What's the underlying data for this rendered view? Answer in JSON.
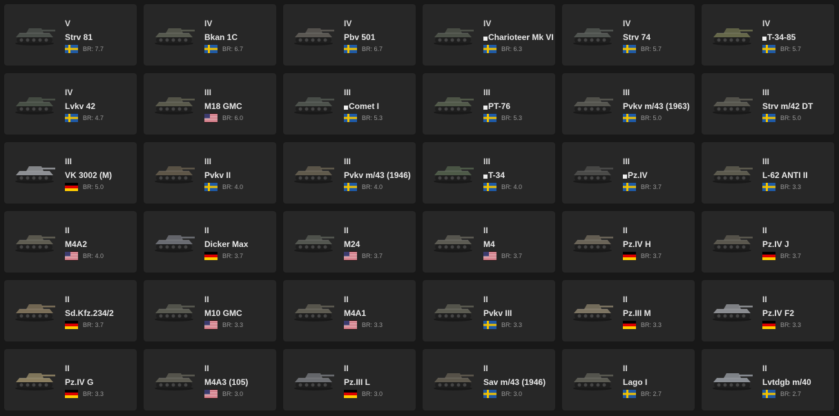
{
  "br_label": "BR:",
  "colors": {
    "background": "#181818",
    "card": "#272727",
    "sweden_blue": "#1f5aa6",
    "sweden_yellow": "#f2c200",
    "germany_red": "#dd0000",
    "germany_gold": "#ffcc00",
    "usa_red": "#b22234",
    "usa_blue": "#3c3b6e"
  },
  "vehicles": [
    {
      "rank": "V",
      "name": "Strv 81",
      "nation": "sweden",
      "br": "7.7",
      "icon": "tank-icon",
      "hue": "#4a4f4a",
      "marked": false
    },
    {
      "rank": "IV",
      "name": "Bkan 1C",
      "nation": "sweden",
      "br": "6.7",
      "icon": "spg-icon",
      "hue": "#56594e",
      "marked": false
    },
    {
      "rank": "IV",
      "name": "Pbv 501",
      "nation": "sweden",
      "br": "6.7",
      "icon": "apc-icon",
      "hue": "#5a5752",
      "marked": false
    },
    {
      "rank": "IV",
      "name": "Charioteer Mk VI",
      "nation": "sweden",
      "br": "6.3",
      "icon": "tank-icon",
      "hue": "#4c5148",
      "marked": true
    },
    {
      "rank": "IV",
      "name": "Strv 74",
      "nation": "sweden",
      "br": "5.7",
      "icon": "tank-icon",
      "hue": "#505450",
      "marked": false
    },
    {
      "rank": "IV",
      "name": "T-34-85",
      "nation": "sweden",
      "br": "5.7",
      "icon": "tank-icon",
      "hue": "#66684a",
      "marked": true
    },
    {
      "rank": "IV",
      "name": "Lvkv 42",
      "nation": "sweden",
      "br": "4.7",
      "icon": "spaa-icon",
      "hue": "#485046",
      "marked": false
    },
    {
      "rank": "III",
      "name": "M18 GMC",
      "nation": "usa",
      "br": "6.0",
      "icon": "tank-destroyer-icon",
      "hue": "#5a5a4c",
      "marked": false
    },
    {
      "rank": "III",
      "name": "Comet I",
      "nation": "sweden",
      "br": "5.3",
      "icon": "tank-icon",
      "hue": "#4d524c",
      "marked": true
    },
    {
      "rank": "III",
      "name": "PT-76",
      "nation": "sweden",
      "br": "5.3",
      "icon": "light-tank-icon",
      "hue": "#525a4a",
      "marked": true
    },
    {
      "rank": "III",
      "name": "Pvkv m/43 (1963)",
      "nation": "sweden",
      "br": "5.0",
      "icon": "tank-destroyer-icon",
      "hue": "#55554f",
      "marked": false
    },
    {
      "rank": "III",
      "name": "Strv m/42 DT",
      "nation": "sweden",
      "br": "5.0",
      "icon": "tank-icon",
      "hue": "#58574f",
      "marked": false
    },
    {
      "rank": "III",
      "name": "VK 3002 (M)",
      "nation": "germany",
      "br": "5.0",
      "icon": "tank-icon",
      "hue": "#8e9094",
      "marked": false
    },
    {
      "rank": "III",
      "name": "Pvkv II",
      "nation": "sweden",
      "br": "4.0",
      "icon": "tank-destroyer-icon",
      "hue": "#5e5648",
      "marked": false
    },
    {
      "rank": "III",
      "name": "Pvkv m/43 (1946)",
      "nation": "sweden",
      "br": "4.0",
      "icon": "tank-destroyer-icon",
      "hue": "#605a4c",
      "marked": false
    },
    {
      "rank": "III",
      "name": "T-34",
      "nation": "sweden",
      "br": "4.0",
      "icon": "tank-icon",
      "hue": "#4e5a48",
      "marked": true
    },
    {
      "rank": "III",
      "name": "Pz.IV",
      "nation": "sweden",
      "br": "3.7",
      "icon": "tank-icon",
      "hue": "#4a4a48",
      "marked": true
    },
    {
      "rank": "III",
      "name": "L-62 ANTI II",
      "nation": "sweden",
      "br": "3.3",
      "icon": "spaa-icon",
      "hue": "#5c5a4e",
      "marked": false
    },
    {
      "rank": "II",
      "name": "M4A2",
      "nation": "usa",
      "br": "4.0",
      "icon": "tank-icon",
      "hue": "#5f5d52",
      "marked": false
    },
    {
      "rank": "II",
      "name": "Dicker Max",
      "nation": "germany",
      "br": "3.7",
      "icon": "tank-destroyer-icon",
      "hue": "#6a6c72",
      "marked": false
    },
    {
      "rank": "II",
      "name": "M24",
      "nation": "usa",
      "br": "3.7",
      "icon": "light-tank-icon",
      "hue": "#535650",
      "marked": false
    },
    {
      "rank": "II",
      "name": "M4",
      "nation": "usa",
      "br": "3.7",
      "icon": "tank-icon",
      "hue": "#5c5b53",
      "marked": false
    },
    {
      "rank": "II",
      "name": "Pz.IV H",
      "nation": "germany",
      "br": "3.7",
      "icon": "tank-icon",
      "hue": "#6a6458",
      "marked": false
    },
    {
      "rank": "II",
      "name": "Pz.IV J",
      "nation": "germany",
      "br": "3.7",
      "icon": "tank-icon",
      "hue": "#5a574e",
      "marked": false
    },
    {
      "rank": "II",
      "name": "Sd.Kfz.234/2",
      "nation": "germany",
      "br": "3.7",
      "icon": "armored-car-icon",
      "hue": "#7a6e58",
      "marked": false
    },
    {
      "rank": "II",
      "name": "M10 GMC",
      "nation": "usa",
      "br": "3.3",
      "icon": "tank-destroyer-icon",
      "hue": "#585950",
      "marked": false
    },
    {
      "rank": "II",
      "name": "M4A1",
      "nation": "usa",
      "br": "3.3",
      "icon": "tank-icon",
      "hue": "#5d5b51",
      "marked": false
    },
    {
      "rank": "II",
      "name": "Pvkv III",
      "nation": "sweden",
      "br": "3.3",
      "icon": "tank-destroyer-icon",
      "hue": "#5a5a50",
      "marked": false
    },
    {
      "rank": "II",
      "name": "Pz.III M",
      "nation": "germany",
      "br": "3.3",
      "icon": "tank-icon",
      "hue": "#7c7462",
      "marked": false
    },
    {
      "rank": "II",
      "name": "Pz.IV F2",
      "nation": "germany",
      "br": "3.3",
      "icon": "tank-icon",
      "hue": "#8a8c90",
      "marked": false
    },
    {
      "rank": "II",
      "name": "Pz.IV G",
      "nation": "germany",
      "br": "3.3",
      "icon": "tank-icon",
      "hue": "#8a7e60",
      "marked": false
    },
    {
      "rank": "II",
      "name": "M4A3 (105)",
      "nation": "usa",
      "br": "3.0",
      "icon": "tank-icon",
      "hue": "#5a5950",
      "marked": false
    },
    {
      "rank": "II",
      "name": "Pz.III L",
      "nation": "germany",
      "br": "3.0",
      "icon": "tank-icon",
      "hue": "#6c6e72",
      "marked": false
    },
    {
      "rank": "II",
      "name": "Sav m/43 (1946)",
      "nation": "sweden",
      "br": "3.0",
      "icon": "spg-icon",
      "hue": "#5c574c",
      "marked": false
    },
    {
      "rank": "II",
      "name": "Lago I",
      "nation": "sweden",
      "br": "2.7",
      "icon": "light-tank-icon",
      "hue": "#5a5a52",
      "marked": false
    },
    {
      "rank": "II",
      "name": "Lvtdgb m/40",
      "nation": "sweden",
      "br": "2.7",
      "icon": "armored-car-icon",
      "hue": "#8a8e94",
      "marked": false
    }
  ]
}
